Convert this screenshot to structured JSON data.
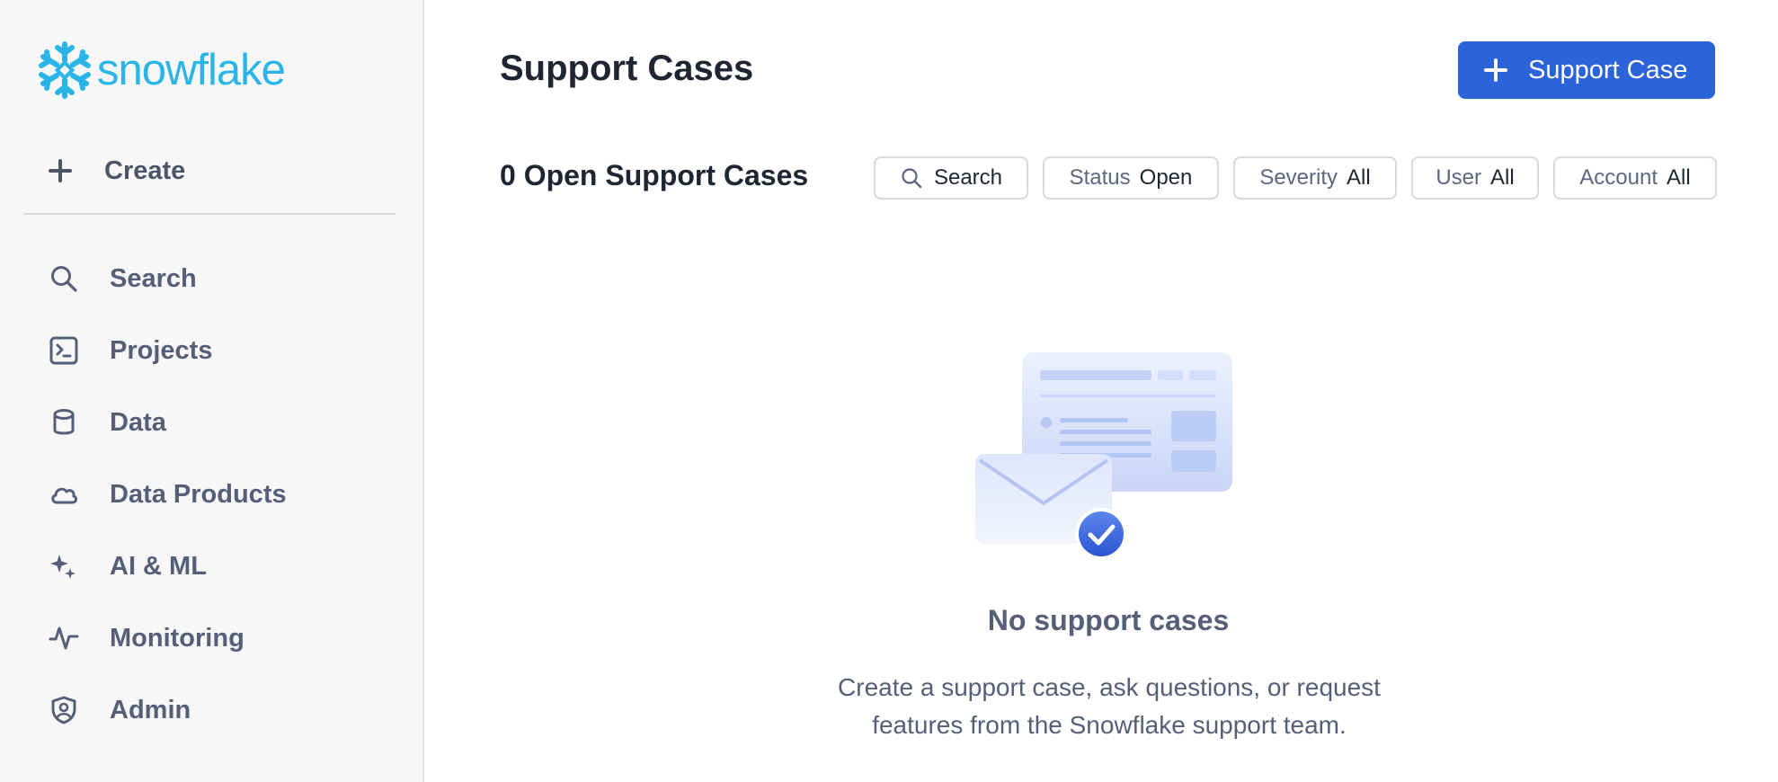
{
  "sidebar": {
    "logo_text": "snowflake",
    "create_label": "Create",
    "items": [
      {
        "label": "Search",
        "icon": "search-icon"
      },
      {
        "label": "Projects",
        "icon": "terminal-icon"
      },
      {
        "label": "Data",
        "icon": "database-icon"
      },
      {
        "label": "Data Products",
        "icon": "cloud-icon"
      },
      {
        "label": "AI & ML",
        "icon": "sparkle-icon"
      },
      {
        "label": "Monitoring",
        "icon": "activity-icon"
      },
      {
        "label": "Admin",
        "icon": "shield-user-icon"
      }
    ]
  },
  "main": {
    "title": "Support Cases",
    "new_case_button": "Support Case",
    "open_count_title": "0 Open Support Cases",
    "filters": {
      "search": "Search",
      "status_label": "Status",
      "status_value": "Open",
      "severity_label": "Severity",
      "severity_value": "All",
      "user_label": "User",
      "user_value": "All",
      "account_label": "Account",
      "account_value": "All"
    },
    "empty_state": {
      "title": "No support cases",
      "description": "Create a support case, ask questions, or request features from the Snowflake support team."
    }
  },
  "colors": {
    "accent": "#2b63d9",
    "logo": "#29b5e8",
    "sidebar_bg": "#f7f7f8"
  }
}
